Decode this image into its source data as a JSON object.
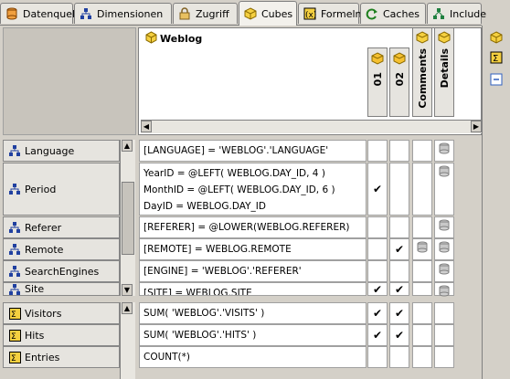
{
  "tabs": [
    {
      "label": "Datenquellen",
      "icon": "database-icon",
      "active": false
    },
    {
      "label": "Dimensionen",
      "icon": "dimension-icon",
      "active": false
    },
    {
      "label": "Zugriff",
      "icon": "lock-icon",
      "active": false
    },
    {
      "label": "Cubes",
      "icon": "cube-icon",
      "active": true
    },
    {
      "label": "Formeln",
      "icon": "formula-icon",
      "active": false
    },
    {
      "label": "Caches",
      "icon": "refresh-icon",
      "active": false
    },
    {
      "label": "Include",
      "icon": "include-icon",
      "active": false
    }
  ],
  "cube": {
    "title": "Weblog"
  },
  "columns": [
    {
      "label": "01"
    },
    {
      "label": "02"
    },
    {
      "label": "Comments"
    },
    {
      "label": "Details"
    }
  ],
  "dimensions": [
    {
      "label": "Language",
      "expr": [
        "[LANGUAGE] = 'WEBLOG'.'LANGUAGE'"
      ],
      "c1": "",
      "c2": ""
    },
    {
      "label": "Period",
      "expr": [
        "YearID = @LEFT( WEBLOG.DAY_ID, 4 )",
        "MonthID = @LEFT( WEBLOG.DAY_ID, 6 )",
        "DayID = WEBLOG.DAY_ID"
      ],
      "c1": "✔",
      "c2": ""
    },
    {
      "label": "Referer",
      "expr": [
        "[REFERER] = @LOWER(WEBLOG.REFERER)"
      ],
      "c1": "",
      "c2": ""
    },
    {
      "label": "Remote",
      "expr": [
        "[REMOTE] = WEBLOG.REMOTE"
      ],
      "c1": "",
      "c2": "✔"
    },
    {
      "label": "SearchEngines",
      "expr": [
        "[ENGINE] = 'WEBLOG'.'REFERER'"
      ],
      "c1": "",
      "c2": ""
    },
    {
      "label": "Site",
      "expr": [
        "[SITE] = WEBLOG.SITE"
      ],
      "c1": "✔",
      "c2": "✔"
    }
  ],
  "measures": [
    {
      "label": "Visitors",
      "expr": "SUM( 'WEBLOG'.'VISITS' )",
      "c1": "✔",
      "c2": "✔"
    },
    {
      "label": "Hits",
      "expr": "SUM( 'WEBLOG'.'HITS' )",
      "c1": "✔",
      "c2": "✔"
    },
    {
      "label": "Entries",
      "expr": "COUNT(*)",
      "c1": "",
      "c2": ""
    }
  ]
}
